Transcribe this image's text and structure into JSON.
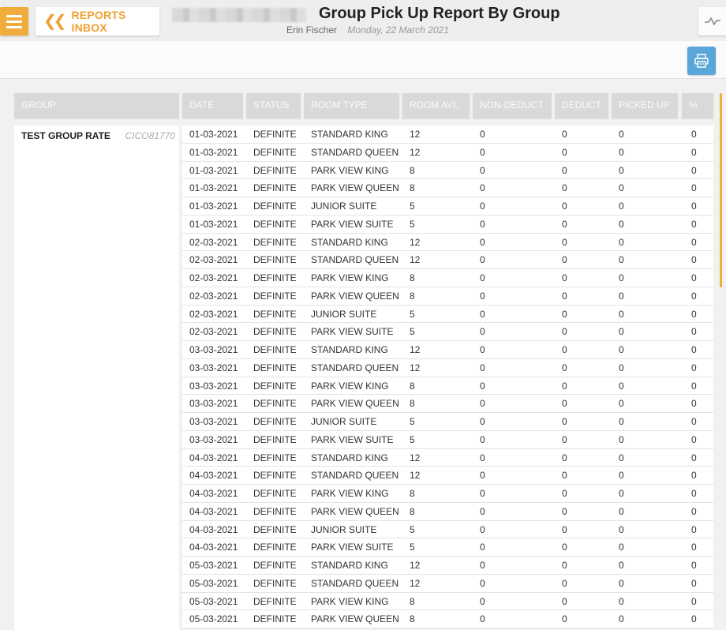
{
  "header": {
    "back_label": "REPORTS INBOX",
    "title": "Group Pick Up Report By Group",
    "user": "Erin Fischer",
    "date": "Monday, 22 March 2021"
  },
  "columns": [
    "GROUP",
    "DATE",
    "STATUS",
    "ROOM TYPE",
    "ROOM AVL.",
    "NON-DEDUCT",
    "DEDUCT",
    "PICKED UP",
    "%"
  ],
  "group": {
    "name": "TEST GROUP RATE",
    "code": "CICO81770"
  },
  "rows": [
    [
      "01-03-2021",
      "DEFINITE",
      "STANDARD KING",
      "12",
      "0",
      "0",
      "0",
      "0"
    ],
    [
      "01-03-2021",
      "DEFINITE",
      "STANDARD QUEEN",
      "12",
      "0",
      "0",
      "0",
      "0"
    ],
    [
      "01-03-2021",
      "DEFINITE",
      "PARK VIEW KING",
      "8",
      "0",
      "0",
      "0",
      "0"
    ],
    [
      "01-03-2021",
      "DEFINITE",
      "PARK VIEW QUEEN",
      "8",
      "0",
      "0",
      "0",
      "0"
    ],
    [
      "01-03-2021",
      "DEFINITE",
      "JUNIOR SUITE",
      "5",
      "0",
      "0",
      "0",
      "0"
    ],
    [
      "01-03-2021",
      "DEFINITE",
      "PARK VIEW SUITE",
      "5",
      "0",
      "0",
      "0",
      "0"
    ],
    [
      "02-03-2021",
      "DEFINITE",
      "STANDARD KING",
      "12",
      "0",
      "0",
      "0",
      "0"
    ],
    [
      "02-03-2021",
      "DEFINITE",
      "STANDARD QUEEN",
      "12",
      "0",
      "0",
      "0",
      "0"
    ],
    [
      "02-03-2021",
      "DEFINITE",
      "PARK VIEW KING",
      "8",
      "0",
      "0",
      "0",
      "0"
    ],
    [
      "02-03-2021",
      "DEFINITE",
      "PARK VIEW QUEEN",
      "8",
      "0",
      "0",
      "0",
      "0"
    ],
    [
      "02-03-2021",
      "DEFINITE",
      "JUNIOR SUITE",
      "5",
      "0",
      "0",
      "0",
      "0"
    ],
    [
      "02-03-2021",
      "DEFINITE",
      "PARK VIEW SUITE",
      "5",
      "0",
      "0",
      "0",
      "0"
    ],
    [
      "03-03-2021",
      "DEFINITE",
      "STANDARD KING",
      "12",
      "0",
      "0",
      "0",
      "0"
    ],
    [
      "03-03-2021",
      "DEFINITE",
      "STANDARD QUEEN",
      "12",
      "0",
      "0",
      "0",
      "0"
    ],
    [
      "03-03-2021",
      "DEFINITE",
      "PARK VIEW KING",
      "8",
      "0",
      "0",
      "0",
      "0"
    ],
    [
      "03-03-2021",
      "DEFINITE",
      "PARK VIEW QUEEN",
      "8",
      "0",
      "0",
      "0",
      "0"
    ],
    [
      "03-03-2021",
      "DEFINITE",
      "JUNIOR SUITE",
      "5",
      "0",
      "0",
      "0",
      "0"
    ],
    [
      "03-03-2021",
      "DEFINITE",
      "PARK VIEW SUITE",
      "5",
      "0",
      "0",
      "0",
      "0"
    ],
    [
      "04-03-2021",
      "DEFINITE",
      "STANDARD KING",
      "12",
      "0",
      "0",
      "0",
      "0"
    ],
    [
      "04-03-2021",
      "DEFINITE",
      "STANDARD QUEEN",
      "12",
      "0",
      "0",
      "0",
      "0"
    ],
    [
      "04-03-2021",
      "DEFINITE",
      "PARK VIEW KING",
      "8",
      "0",
      "0",
      "0",
      "0"
    ],
    [
      "04-03-2021",
      "DEFINITE",
      "PARK VIEW QUEEN",
      "8",
      "0",
      "0",
      "0",
      "0"
    ],
    [
      "04-03-2021",
      "DEFINITE",
      "JUNIOR SUITE",
      "5",
      "0",
      "0",
      "0",
      "0"
    ],
    [
      "04-03-2021",
      "DEFINITE",
      "PARK VIEW SUITE",
      "5",
      "0",
      "0",
      "0",
      "0"
    ],
    [
      "05-03-2021",
      "DEFINITE",
      "STANDARD KING",
      "12",
      "0",
      "0",
      "0",
      "0"
    ],
    [
      "05-03-2021",
      "DEFINITE",
      "STANDARD QUEEN",
      "12",
      "0",
      "0",
      "0",
      "0"
    ],
    [
      "05-03-2021",
      "DEFINITE",
      "PARK VIEW KING",
      "8",
      "0",
      "0",
      "0",
      "0"
    ],
    [
      "05-03-2021",
      "DEFINITE",
      "PARK VIEW QUEEN",
      "8",
      "0",
      "0",
      "0",
      "0"
    ]
  ],
  "icons": {
    "menu": "hamburger-menu-icon",
    "back": "double-chevron-left-icon",
    "chart": "line-chart-icon",
    "print": "printer-icon"
  },
  "colors": {
    "accent": "#f0ad3c",
    "print_button": "#5aa6d8"
  }
}
